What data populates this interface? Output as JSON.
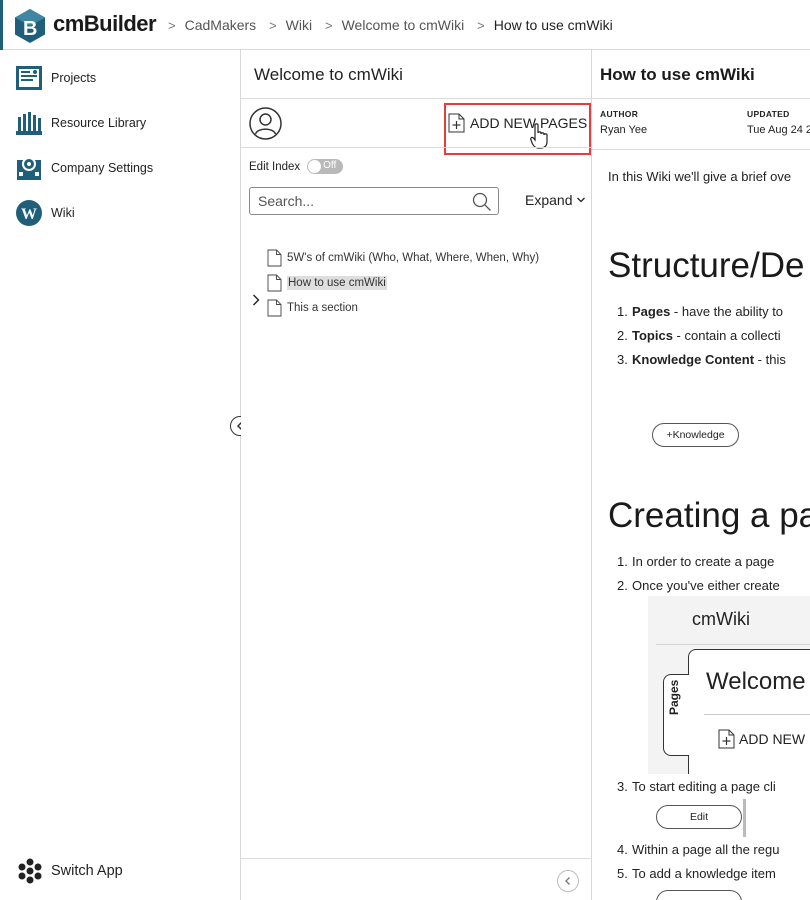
{
  "app": {
    "brand": "cmBuilder",
    "accent_color": "#1f5f7a",
    "highlight_color": "#e53c3c"
  },
  "breadcrumb": [
    "CadMakers",
    "Wiki",
    "Welcome to cmWiki",
    "How to use cmWiki"
  ],
  "sidebar": {
    "items": [
      {
        "label": "Projects",
        "icon": "projects-icon"
      },
      {
        "label": "Resource Library",
        "icon": "library-icon"
      },
      {
        "label": "Company Settings",
        "icon": "company-settings-icon"
      },
      {
        "label": "Wiki",
        "icon": "wiki-icon"
      }
    ],
    "switch_app": "Switch App"
  },
  "index_panel": {
    "title": "Welcome to cmWiki",
    "add_pages_label": "ADD NEW PAGES",
    "edit_index_label": "Edit Index",
    "edit_index_state": "Off",
    "search_placeholder": "Search...",
    "expand_label": "Expand",
    "tree": [
      {
        "label": "5W's of cmWiki (Who, What, Where, When, Why)",
        "selected": false,
        "has_children": false
      },
      {
        "label": "How to use cmWiki",
        "selected": true,
        "has_children": false
      },
      {
        "label": "This a section",
        "selected": false,
        "has_children": true
      }
    ]
  },
  "article": {
    "title": "How to use cmWiki",
    "author_label": "AUTHOR",
    "author": "Ryan Yee",
    "updated_label": "UPDATED",
    "updated": "Tue Aug 24 2",
    "intro": "In this Wiki we'll give a brief ove",
    "section1": {
      "heading": "Structure/De",
      "items": [
        {
          "num": "1.",
          "bold": "Pages",
          "text": " - have the ability to"
        },
        {
          "num": "2.",
          "bold": "Topics",
          "text": " - contain a collecti"
        },
        {
          "num": "3.",
          "bold": "Knowledge Content",
          "text": " - this"
        }
      ],
      "button": "+Knowledge"
    },
    "section2": {
      "heading": "Creating a pa",
      "items": [
        {
          "num": "1.",
          "text": "In order to create a page"
        },
        {
          "num": "2.",
          "text": "Once you've either create"
        },
        {
          "num": "3.",
          "text": "To start editing a page cli"
        },
        {
          "num": "4.",
          "text": "Within a page all the regu"
        },
        {
          "num": "5.",
          "text": "To add a knowledge item"
        }
      ],
      "edit_button": "Edit",
      "embedded": {
        "title": "cmWiki",
        "tab": "Pages",
        "welcome": "Welcome",
        "add": "ADD NEW"
      }
    }
  }
}
